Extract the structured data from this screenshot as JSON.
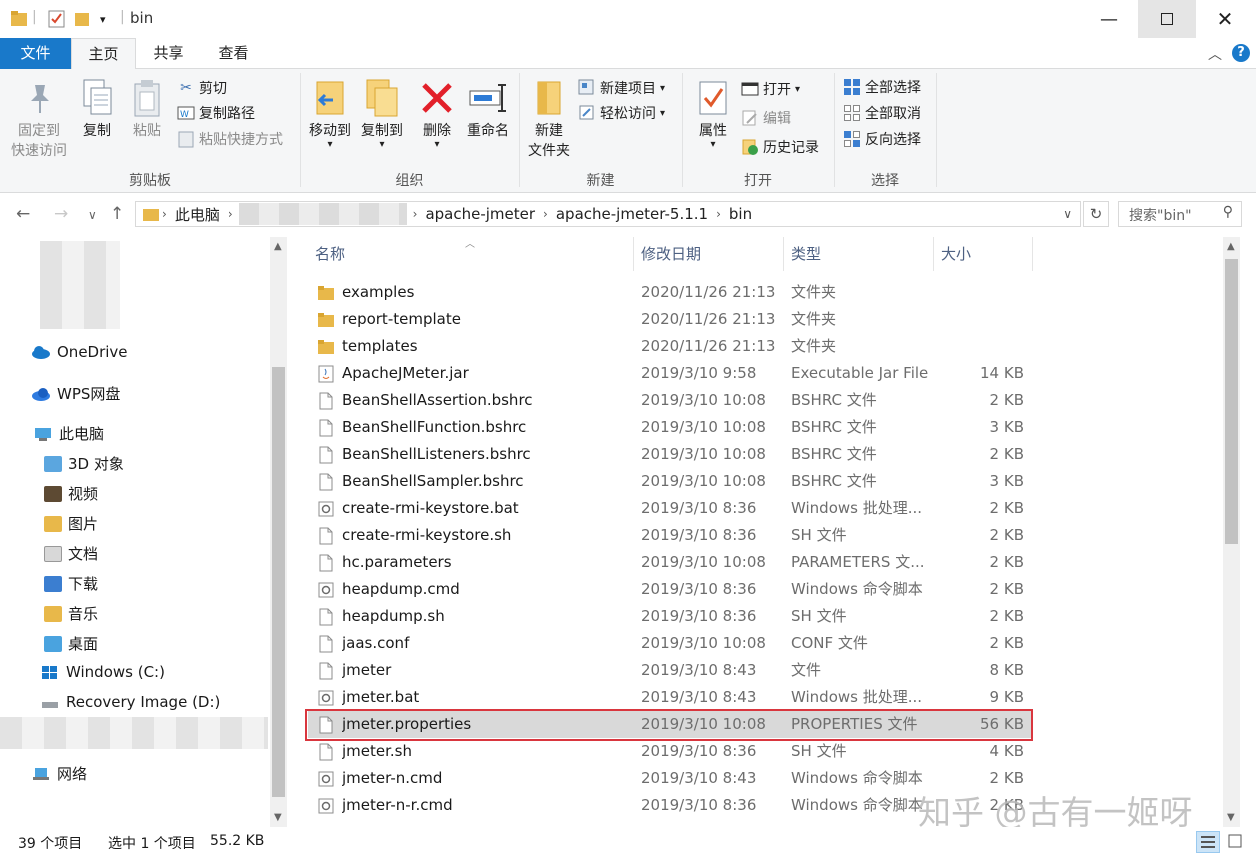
{
  "window": {
    "title": "bin"
  },
  "tabs": {
    "file": "文件",
    "home": "主页",
    "share": "共享",
    "view": "查看"
  },
  "ribbon": {
    "clipboard": {
      "label": "剪贴板",
      "pin_line1": "固定到",
      "pin_line2": "快速访问",
      "copy": "复制",
      "paste": "粘贴",
      "cut": "剪切",
      "copy_path": "复制路径",
      "paste_shortcut": "粘贴快捷方式"
    },
    "organize": {
      "label": "组织",
      "move_to": "移动到",
      "copy_to": "复制到",
      "delete": "删除",
      "rename": "重命名"
    },
    "new": {
      "label": "新建",
      "new_folder_line1": "新建",
      "new_folder_line2": "文件夹",
      "new_item": "新建项目",
      "easy_access": "轻松访问"
    },
    "open": {
      "label": "打开",
      "properties": "属性",
      "open": "打开",
      "edit": "编辑",
      "history": "历史记录"
    },
    "select": {
      "label": "选择",
      "select_all": "全部选择",
      "select_none": "全部取消",
      "invert": "反向选择"
    }
  },
  "address": {
    "root": "此电脑",
    "crumbs": [
      "apache-jmeter",
      "apache-jmeter-5.1.1",
      "bin"
    ]
  },
  "search": {
    "placeholder": "搜索\"bin\""
  },
  "navpane": {
    "items": [
      "OneDrive",
      "WPS网盘",
      "此电脑",
      "3D 对象",
      "视频",
      "图片",
      "文档",
      "下载",
      "音乐",
      "桌面",
      "Windows (C:)",
      "Recovery Image (D:)",
      "网络"
    ]
  },
  "columns": {
    "name": "名称",
    "date": "修改日期",
    "type": "类型",
    "size": "大小"
  },
  "files": [
    {
      "name": "examples",
      "date": "2020/11/26 21:13",
      "type": "文件夹",
      "size": "",
      "icon": "folder"
    },
    {
      "name": "report-template",
      "date": "2020/11/26 21:13",
      "type": "文件夹",
      "size": "",
      "icon": "folder"
    },
    {
      "name": "templates",
      "date": "2020/11/26 21:13",
      "type": "文件夹",
      "size": "",
      "icon": "folder"
    },
    {
      "name": "ApacheJMeter.jar",
      "date": "2019/3/10 9:58",
      "type": "Executable Jar File",
      "size": "14 KB",
      "icon": "jar"
    },
    {
      "name": "BeanShellAssertion.bshrc",
      "date": "2019/3/10 10:08",
      "type": "BSHRC 文件",
      "size": "2 KB",
      "icon": "file"
    },
    {
      "name": "BeanShellFunction.bshrc",
      "date": "2019/3/10 10:08",
      "type": "BSHRC 文件",
      "size": "3 KB",
      "icon": "file"
    },
    {
      "name": "BeanShellListeners.bshrc",
      "date": "2019/3/10 10:08",
      "type": "BSHRC 文件",
      "size": "2 KB",
      "icon": "file"
    },
    {
      "name": "BeanShellSampler.bshrc",
      "date": "2019/3/10 10:08",
      "type": "BSHRC 文件",
      "size": "3 KB",
      "icon": "file"
    },
    {
      "name": "create-rmi-keystore.bat",
      "date": "2019/3/10 8:36",
      "type": "Windows 批处理...",
      "size": "2 KB",
      "icon": "script"
    },
    {
      "name": "create-rmi-keystore.sh",
      "date": "2019/3/10 8:36",
      "type": "SH 文件",
      "size": "2 KB",
      "icon": "file"
    },
    {
      "name": "hc.parameters",
      "date": "2019/3/10 10:08",
      "type": "PARAMETERS 文...",
      "size": "2 KB",
      "icon": "file"
    },
    {
      "name": "heapdump.cmd",
      "date": "2019/3/10 8:36",
      "type": "Windows 命令脚本",
      "size": "2 KB",
      "icon": "script"
    },
    {
      "name": "heapdump.sh",
      "date": "2019/3/10 8:36",
      "type": "SH 文件",
      "size": "2 KB",
      "icon": "file"
    },
    {
      "name": "jaas.conf",
      "date": "2019/3/10 10:08",
      "type": "CONF 文件",
      "size": "2 KB",
      "icon": "file"
    },
    {
      "name": "jmeter",
      "date": "2019/3/10 8:43",
      "type": "文件",
      "size": "8 KB",
      "icon": "file"
    },
    {
      "name": "jmeter.bat",
      "date": "2019/3/10 8:43",
      "type": "Windows 批处理...",
      "size": "9 KB",
      "icon": "script"
    },
    {
      "name": "jmeter.properties",
      "date": "2019/3/10 10:08",
      "type": "PROPERTIES 文件",
      "size": "56 KB",
      "icon": "file",
      "selected": true
    },
    {
      "name": "jmeter.sh",
      "date": "2019/3/10 8:36",
      "type": "SH 文件",
      "size": "4 KB",
      "icon": "file"
    },
    {
      "name": "jmeter-n.cmd",
      "date": "2019/3/10 8:43",
      "type": "Windows 命令脚本",
      "size": "2 KB",
      "icon": "script"
    },
    {
      "name": "jmeter-n-r.cmd",
      "date": "2019/3/10 8:36",
      "type": "Windows 命令脚本",
      "size": "2 KB",
      "icon": "script"
    }
  ],
  "status": {
    "count": "39 个项目",
    "selected": "选中 1 个项目",
    "size": "55.2 KB"
  },
  "watermark": "知乎 @古有一姬呀",
  "colors": {
    "accent": "#1979ca",
    "folder": "#e8b84a",
    "highlight": "#d9363e",
    "selected_row": "#d9d9d9",
    "header_text": "#4d6082"
  }
}
